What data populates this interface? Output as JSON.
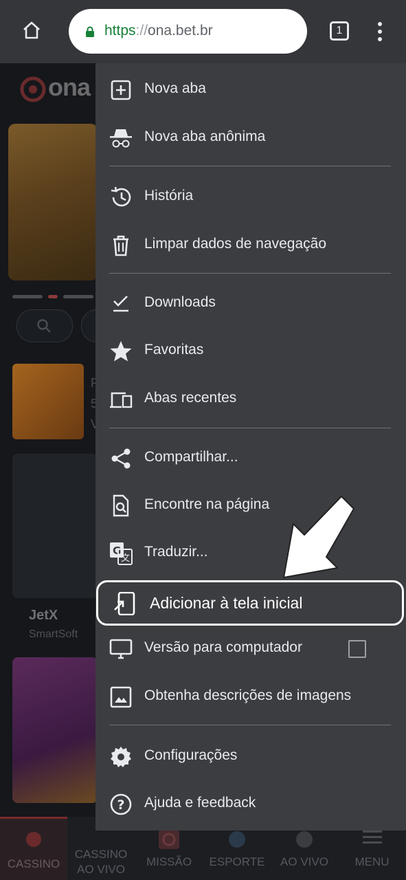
{
  "browser": {
    "url_scheme": "https",
    "url_sep": "://",
    "url_host": "ona.bet.br",
    "tab_count": "1"
  },
  "page": {
    "logo_text": "ona",
    "game_jetx_name": "JetX",
    "game_jetx_provider": "SmartSoft",
    "game_side_1": "P",
    "game_side_2": "5",
    "game_side_3": "V"
  },
  "bottom_nav": [
    {
      "label": "CASSINO"
    },
    {
      "label": "CASSINO AO VIVO"
    },
    {
      "label": "MISSÃO"
    },
    {
      "label": "ESPORTE"
    },
    {
      "label": "AO VIVO"
    },
    {
      "label": "MENU"
    }
  ],
  "menu": {
    "new_tab": "Nova aba",
    "incognito_tab": "Nova aba anônima",
    "history": "História",
    "clear_data": "Limpar dados de navegação",
    "downloads": "Downloads",
    "bookmarks": "Favoritas",
    "recent_tabs": "Abas recentes",
    "share": "Compartilhar...",
    "find_in_page": "Encontre na página",
    "translate": "Traduzir...",
    "add_to_home": "Adicionar à tela inicial",
    "desktop_site": "Versão para computador",
    "desktop_site_checked": false,
    "image_descriptions": "Obtenha descrições de imagens",
    "settings": "Configurações",
    "help": "Ajuda e feedback"
  },
  "icons": {
    "home": "home-icon",
    "lock": "lock-icon",
    "more": "more-vert-icon",
    "highlight_arrow": "arrow-pointer-icon"
  },
  "colors": {
    "menu_bg": "#3c3d41",
    "toolbar_bg": "#35363a",
    "url_scheme": "#188038",
    "highlight_border": "#ffffff"
  }
}
